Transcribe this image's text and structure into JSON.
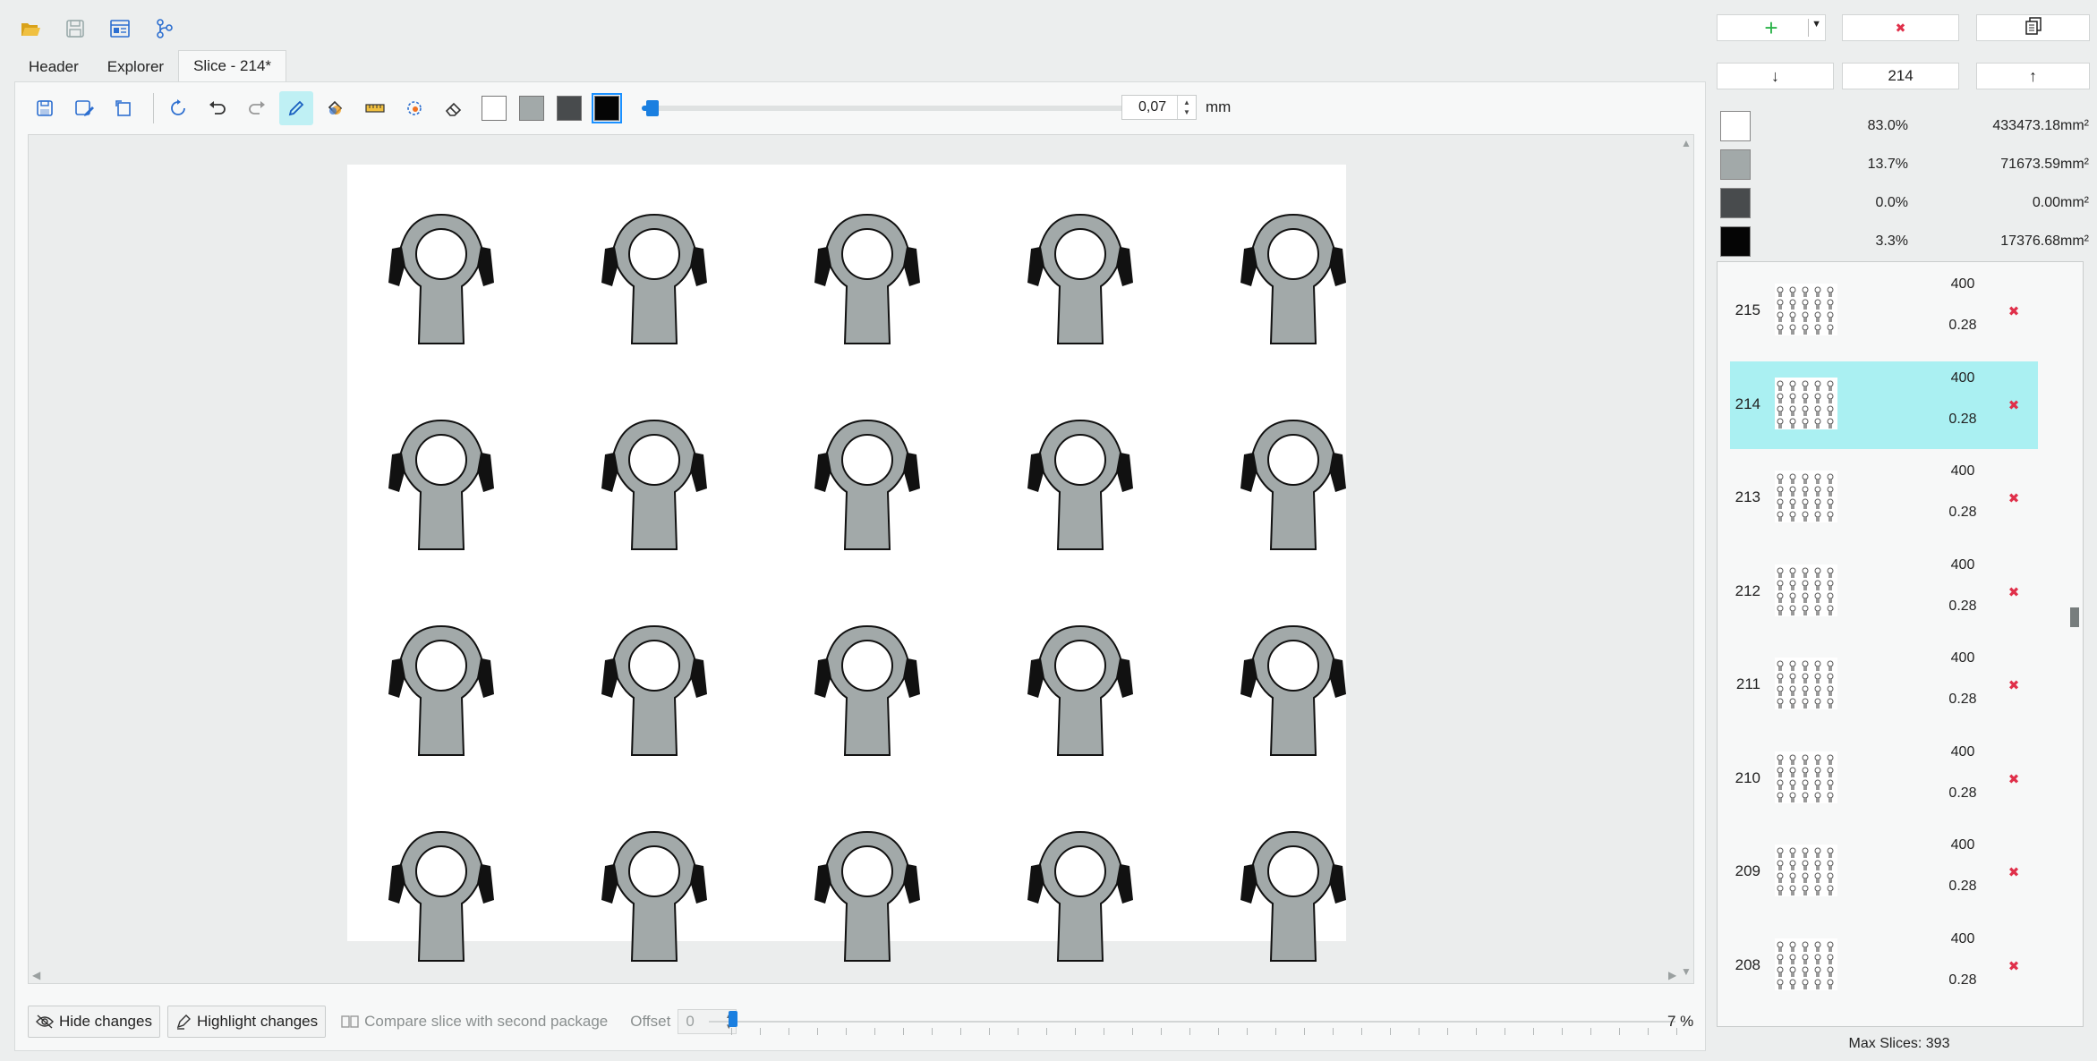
{
  "file_toolbar": {
    "icons": [
      "open-folder-icon",
      "save-icon",
      "save-as-icon",
      "git-branch-icon"
    ]
  },
  "tabs": [
    {
      "label": "Header",
      "active": false
    },
    {
      "label": "Explorer",
      "active": false
    },
    {
      "label": "Slice - 214*",
      "active": true
    }
  ],
  "editor_toolbar": {
    "brush_size": "0,07",
    "brush_unit": "mm",
    "brush_slider_fraction": 0.01,
    "colors": [
      "#ffffff",
      "#a2a9a9",
      "#484b4d",
      "#050505"
    ],
    "selected_color_index": 3
  },
  "bottom_bar": {
    "hide_changes": "Hide changes",
    "highlight_changes": "Highlight changes",
    "compare_label": "Compare slice with second package",
    "offset_label": "Offset",
    "offset_value": "0",
    "zoom_value": "7 %",
    "zoom_fraction": 0.02
  },
  "right_panel": {
    "current_slice": "214",
    "stats": [
      {
        "color": "#ffffff",
        "percent": "83.0%",
        "area": "433473.18mm²"
      },
      {
        "color": "#a2a9a9",
        "percent": "13.7%",
        "area": "71673.59mm²"
      },
      {
        "color": "#484b4d",
        "percent": "0.0%",
        "area": "0.00mm²"
      },
      {
        "color": "#050505",
        "percent": "3.3%",
        "area": "17376.68mm²"
      }
    ],
    "layers": [
      {
        "number": "215",
        "exposure": "400",
        "height": "0.28",
        "selected": false
      },
      {
        "number": "214",
        "exposure": "400",
        "height": "0.28",
        "selected": true
      },
      {
        "number": "213",
        "exposure": "400",
        "height": "0.28",
        "selected": false
      },
      {
        "number": "212",
        "exposure": "400",
        "height": "0.28",
        "selected": false
      },
      {
        "number": "211",
        "exposure": "400",
        "height": "0.28",
        "selected": false
      },
      {
        "number": "210",
        "exposure": "400",
        "height": "0.28",
        "selected": false
      },
      {
        "number": "209",
        "exposure": "400",
        "height": "0.28",
        "selected": false
      },
      {
        "number": "208",
        "exposure": "400",
        "height": "0.28",
        "selected": false
      }
    ],
    "max_slices": "Max Slices: 393"
  }
}
